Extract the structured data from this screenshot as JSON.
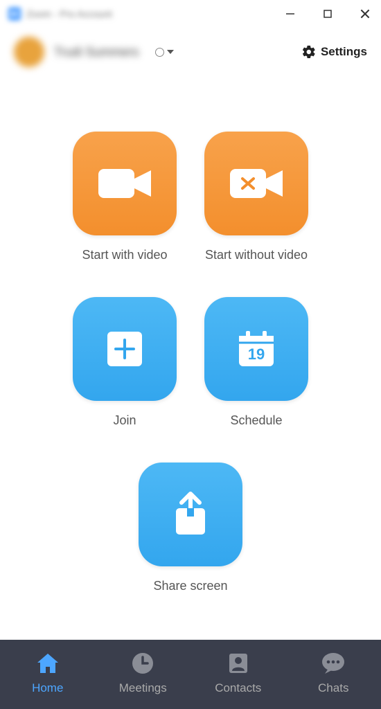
{
  "titlebar": {
    "app_title": "Zoom - Pro Account"
  },
  "header": {
    "username": "Trudi Summers",
    "settings_label": "Settings"
  },
  "tiles": {
    "start_video": "Start with video",
    "start_novideo": "Start without video",
    "join": "Join",
    "schedule": "Schedule",
    "schedule_day": "19",
    "share": "Share screen"
  },
  "nav": {
    "home": "Home",
    "meetings": "Meetings",
    "contacts": "Contacts",
    "chats": "Chats"
  }
}
